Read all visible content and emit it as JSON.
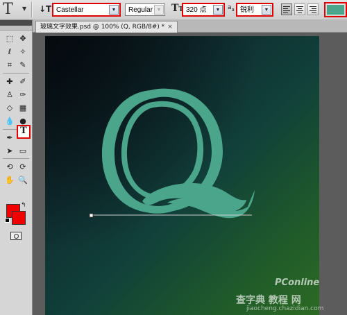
{
  "optionsbar": {
    "tool_glyph": "T",
    "font_family": "Castellar",
    "font_style": "Regular",
    "font_size": "320 点",
    "antialias": "锐利",
    "antialias_icon": "a",
    "antialias_icon2": "a",
    "text_color": "#4aa58a"
  },
  "document": {
    "tab_title": "玻璃文字效果.psd @ 100% (Q, RGB/8#) *",
    "letter": "Q"
  },
  "tools": {
    "type_tool_glyph": "T",
    "foreground_color": "#f00000",
    "background_color": "#f00000"
  },
  "watermark": {
    "brand": "PConline",
    "site_name": "查字典 教程 网",
    "site_url": "jiaocheng.chazidian.com"
  },
  "colors": {
    "highlight": "#e00000",
    "glyph_fill": "#4aa58a"
  }
}
